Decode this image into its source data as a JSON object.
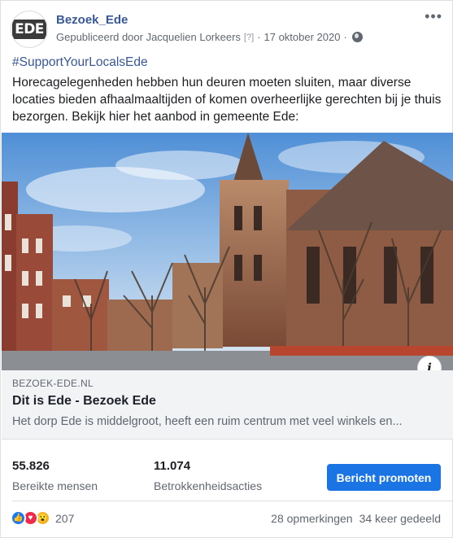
{
  "post": {
    "page_name": "Bezoek_Ede",
    "avatar_text": "EDE",
    "published_by": "Gepubliceerd door Jacquelien Lorkeers",
    "help_mark": "[?]",
    "date": "17 oktober 2020",
    "separator": "·",
    "more_icon": "more-horizontal-icon",
    "hashtag": "#SupportYourLocalsEde",
    "text": "Horecagelegenheden hebben hun deuren moeten sluiten, maar diverse locaties bieden afhaalmaaltijden of komen overheerlijke gerechten bij je thuis bezorgen. Bekijk hier het aanbod in gemeente Ede:"
  },
  "link": {
    "domain": "BEZOEK-EDE.NL",
    "title": "Dit is Ede - Bezoek Ede",
    "description": "Het dorp Ede is middelgroot, heeft een ruim centrum met veel winkels en...",
    "info_icon": "i"
  },
  "insights": {
    "reach_value": "55.826",
    "reach_label": "Bereikte mensen",
    "engagement_value": "11.074",
    "engagement_label": "Betrokkenheidsacties",
    "promote_label": "Bericht promoten"
  },
  "footer": {
    "reaction_count": "207",
    "comments": "28 opmerkingen",
    "shares": "34 keer gedeeld"
  },
  "colors": {
    "link_blue": "#385898",
    "button_blue": "#1b74e4",
    "like": "#1877f2",
    "love": "#f0284a",
    "wow": "#f7b125"
  }
}
